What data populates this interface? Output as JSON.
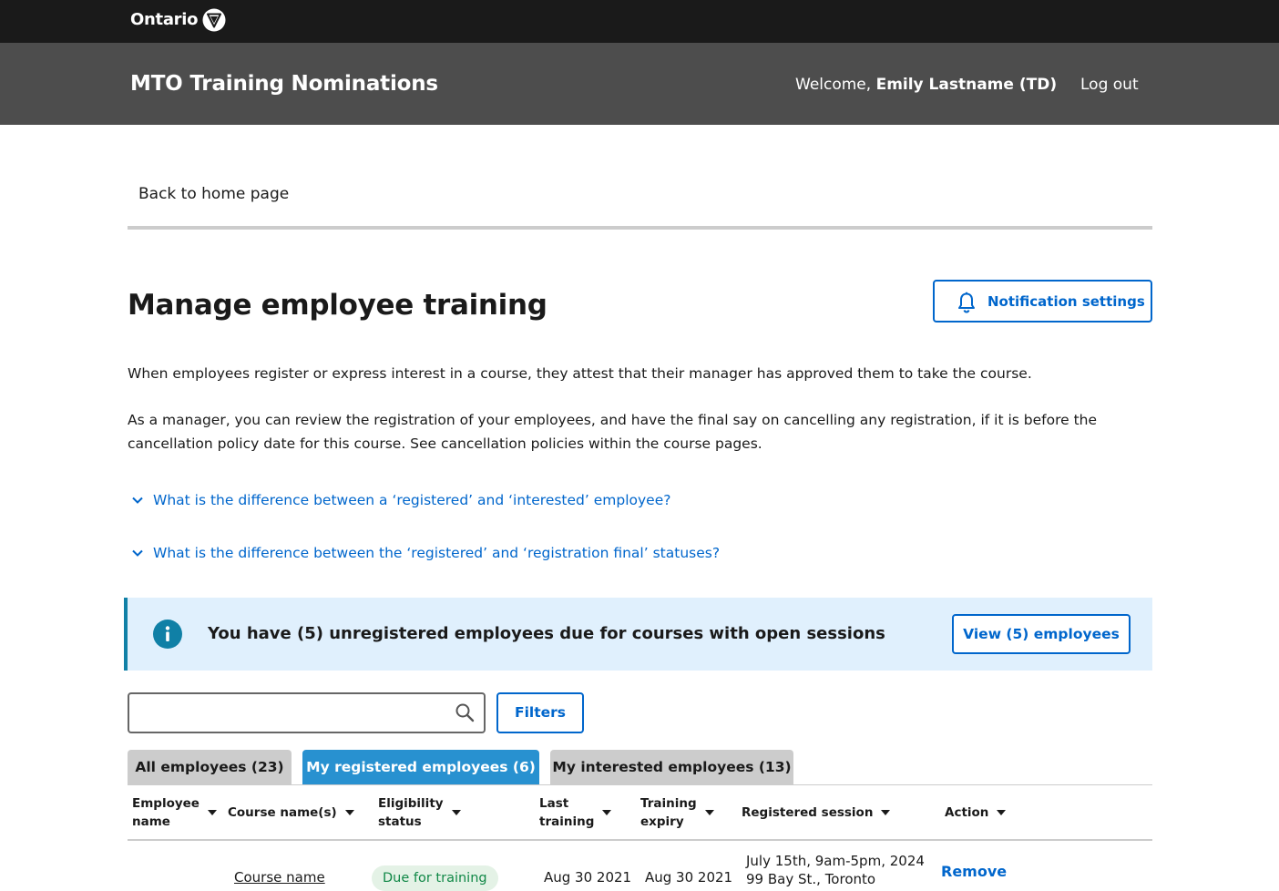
{
  "brand": {
    "logo_text": "Ontario",
    "logo_icon": "trillium-icon"
  },
  "header": {
    "app_title": "MTO Training Nominations",
    "welcome_prefix": "Welcome, ",
    "user_name": "Emily Lastname (TD)",
    "logout_label": "Log out"
  },
  "nav": {
    "back_label": "Back to home page"
  },
  "page": {
    "title": "Manage employee training",
    "notification_button": "Notification settings",
    "paragraph_1": "When employees register or express interest in a course, they attest that their manager has approved them to take the course.",
    "paragraph_2": "As a manager, you can review the registration of your employees, and have the final say on cancelling any registration, if it is before the cancellation policy date for this course. See cancellation policies within the course pages.",
    "faq": [
      "What is the difference between a ‘registered’ and ‘interested’ employee?",
      "What is the difference between the ‘registered’ and ‘registration final’ statuses?"
    ]
  },
  "callout": {
    "message": "You have (5) unregistered employees due for courses with open sessions",
    "button": "View (5) employees"
  },
  "search": {
    "placeholder": "",
    "value": "",
    "filters_label": "Filters"
  },
  "tabs": [
    {
      "label": "All employees (23)",
      "active": false
    },
    {
      "label": "My registered employees (6)",
      "active": true
    },
    {
      "label": "My interested employees (13)",
      "active": false
    }
  ],
  "table": {
    "headers": [
      {
        "line1": "Employee",
        "line2": "name"
      },
      {
        "line1": "Course name(s)",
        "line2": ""
      },
      {
        "line1": "Eligibility",
        "line2": "status"
      },
      {
        "line1": "Last",
        "line2": "training"
      },
      {
        "line1": "Training",
        "line2": "expiry"
      },
      {
        "line1": "Registered session",
        "line2": ""
      },
      {
        "line1": "Action",
        "line2": ""
      }
    ],
    "rows": [
      {
        "course": "Course name",
        "status": "Due for training",
        "last_training": "Aug 30 2021",
        "training_expiry": "Aug 30 2021",
        "session_date": "July 15th, 9am-5pm, 2024",
        "session_location": "99 Bay St., Toronto",
        "action": "Remove"
      }
    ]
  },
  "colors": {
    "topbar": "#1a1a1a",
    "appbar": "#4d4d4d",
    "link": "#0066cc",
    "active_tab": "#2891d0",
    "callout_bg": "#e0f0fd",
    "callout_border": "#1080a6",
    "status_bg": "#e4f2e6",
    "status_text": "#118847"
  }
}
